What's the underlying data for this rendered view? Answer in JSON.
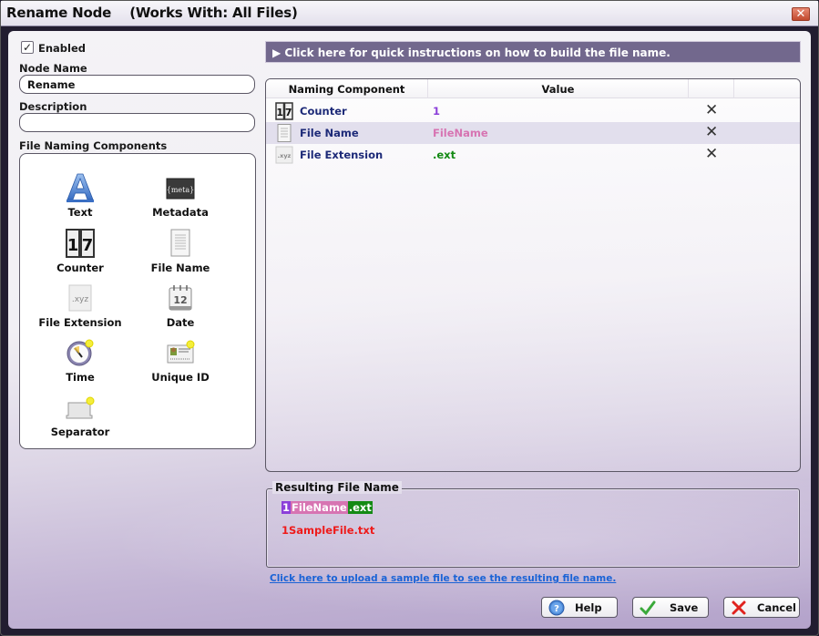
{
  "window": {
    "title": "Rename Node    (Works With: All Files)",
    "close_label": "✕"
  },
  "left": {
    "enabled_checked": "✓",
    "enabled_label": "Enabled",
    "node_name_label": "Node Name",
    "node_name_value": "Rename",
    "description_label": "Description",
    "description_value": "",
    "components_label": "File Naming Components",
    "components": [
      {
        "label": "Text",
        "icon": "text-icon"
      },
      {
        "label": "Metadata",
        "icon": "metadata-icon"
      },
      {
        "label": "Counter",
        "icon": "counter-icon"
      },
      {
        "label": "File Name",
        "icon": "file-name-icon"
      },
      {
        "label": "File Extension",
        "icon": "file-extension-icon"
      },
      {
        "label": "Date",
        "icon": "calendar-icon"
      },
      {
        "label": "Time",
        "icon": "clock-icon"
      },
      {
        "label": "Unique ID",
        "icon": "id-card-icon"
      },
      {
        "label": "Separator",
        "icon": "separator-icon"
      }
    ]
  },
  "instructions": {
    "arrow": "▶",
    "text": "Click here for quick instructions on how to build the file name."
  },
  "grid": {
    "headers": [
      "Naming Component",
      "Value",
      "",
      ""
    ],
    "rows": [
      {
        "name": "Counter",
        "value": "1",
        "value_color": "#8b3fd9",
        "icon": "counter-icon",
        "delete": "✕"
      },
      {
        "name": "File Name",
        "value": "FileName",
        "value_color": "#d774b2",
        "icon": "file-name-icon",
        "delete": "✕"
      },
      {
        "name": "File Extension",
        "value": ".ext",
        "value_color": "#148a14",
        "icon": "file-extension-icon",
        "delete": "✕"
      }
    ]
  },
  "result": {
    "legend": "Resulting File Name",
    "segments": [
      "1",
      "FileName",
      ".ext"
    ],
    "sample": "1SampleFile.txt"
  },
  "upload_link": "Click here to upload a sample file to see the resulting file name.",
  "buttons": {
    "help": "Help",
    "save": "Save",
    "cancel": "Cancel"
  },
  "colors": {
    "accent_bar": "#72688d",
    "counter": "#8b3fd9",
    "filename": "#d774b2",
    "extension": "#148a14",
    "sample": "#ee1b1b",
    "link": "#1a63d6"
  }
}
